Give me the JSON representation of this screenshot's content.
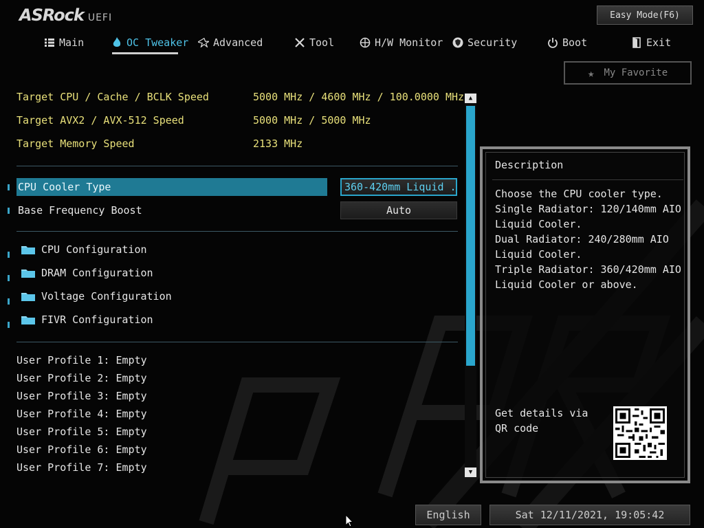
{
  "brand": {
    "name": "ASRock",
    "suffix": "UEFI"
  },
  "header": {
    "easy_mode_label": "Easy Mode(F6)",
    "favorite_label": "My Favorite"
  },
  "nav": {
    "items": [
      {
        "label": "Main",
        "icon": "list-icon"
      },
      {
        "label": "OC Tweaker",
        "icon": "flame-icon",
        "active": true
      },
      {
        "label": "Advanced",
        "icon": "star-icon"
      },
      {
        "label": "Tool",
        "icon": "tools-icon"
      },
      {
        "label": "H/W Monitor",
        "icon": "monitor-icon"
      },
      {
        "label": "Security",
        "icon": "shield-icon"
      },
      {
        "label": "Boot",
        "icon": "power-icon"
      },
      {
        "label": "Exit",
        "icon": "exit-icon"
      }
    ]
  },
  "targets": [
    {
      "label": "Target CPU / Cache / BCLK Speed",
      "value": "5000 MHz / 4600 MHz / 100.0000 MHz"
    },
    {
      "label": "Target AVX2 / AVX-512 Speed",
      "value": "5000 MHz / 5000 MHz"
    },
    {
      "label": "Target Memory Speed",
      "value": "2133 MHz"
    }
  ],
  "settings": [
    {
      "label": "CPU Cooler Type",
      "value": "360-420mm Liquid ...",
      "selected": true
    },
    {
      "label": "Base Frequency Boost",
      "value": "Auto",
      "selected": false
    }
  ],
  "folders": [
    {
      "label": "CPU Configuration"
    },
    {
      "label": "DRAM Configuration"
    },
    {
      "label": "Voltage Configuration"
    },
    {
      "label": "FIVR Configuration"
    }
  ],
  "profiles": [
    "User Profile 1: Empty",
    "User Profile 2: Empty",
    "User Profile 3: Empty",
    "User Profile 4: Empty",
    "User Profile 5: Empty",
    "User Profile 6: Empty",
    "User Profile 7: Empty"
  ],
  "description": {
    "title": "Description",
    "text": "Choose the CPU cooler type.\nSingle Radiator: 120/140mm AIO\nLiquid Cooler.\nDual Radiator: 240/280mm AIO\nLiquid Cooler.\nTriple Radiator: 360/420mm AIO\nLiquid Cooler or above.",
    "qr_text": "Get details via QR code"
  },
  "footer": {
    "language": "English",
    "datetime": "Sat 12/11/2021, 19:05:42"
  },
  "colors": {
    "accent": "#2aa6cc",
    "highlight": "#1f7a94",
    "target_text": "#e8e07a"
  }
}
